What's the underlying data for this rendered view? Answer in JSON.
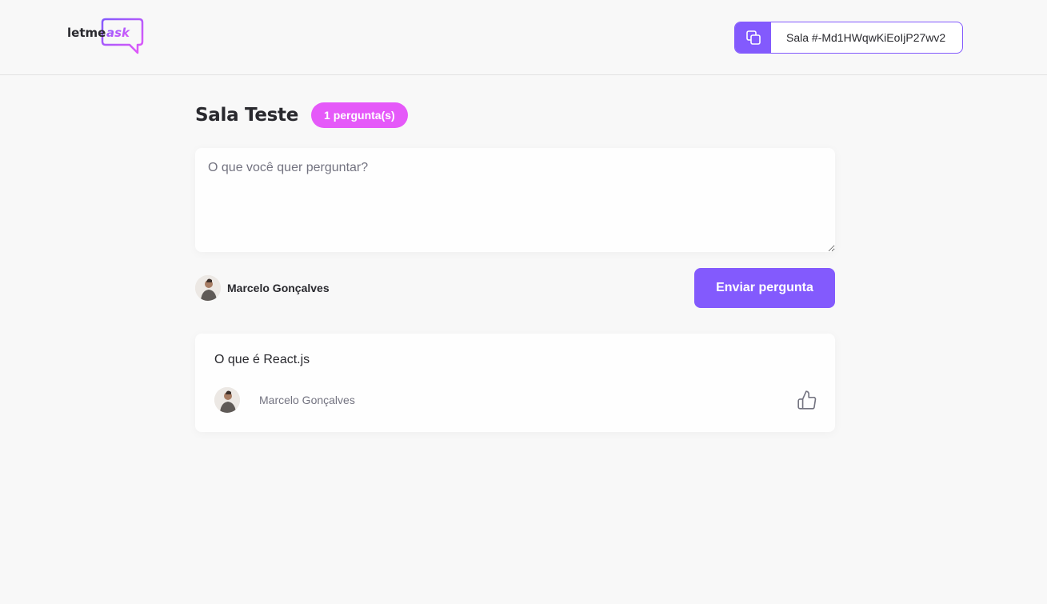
{
  "header": {
    "logo_text_prefix": "letme",
    "logo_text_accent": "ask",
    "room_code_label": "Sala #-Md1HWqwKiEoIjP27wv2"
  },
  "room": {
    "title": "Sala Teste",
    "question_count_badge": "1 pergunta(s)"
  },
  "form": {
    "placeholder": "O que você quer perguntar?",
    "value": "",
    "user_name": "Marcelo Gonçalves",
    "submit_label": "Enviar pergunta"
  },
  "questions": [
    {
      "content": "O que é React.js",
      "author_name": "Marcelo Gonçalves"
    }
  ],
  "colors": {
    "primary": "#835afd",
    "pink": "#e559f9",
    "background": "#f8f8f8",
    "text": "#29292e",
    "muted": "#737380"
  },
  "icons": {
    "copy": "copy-icon",
    "like": "thumbs-up-icon",
    "avatar": "user-avatar"
  }
}
